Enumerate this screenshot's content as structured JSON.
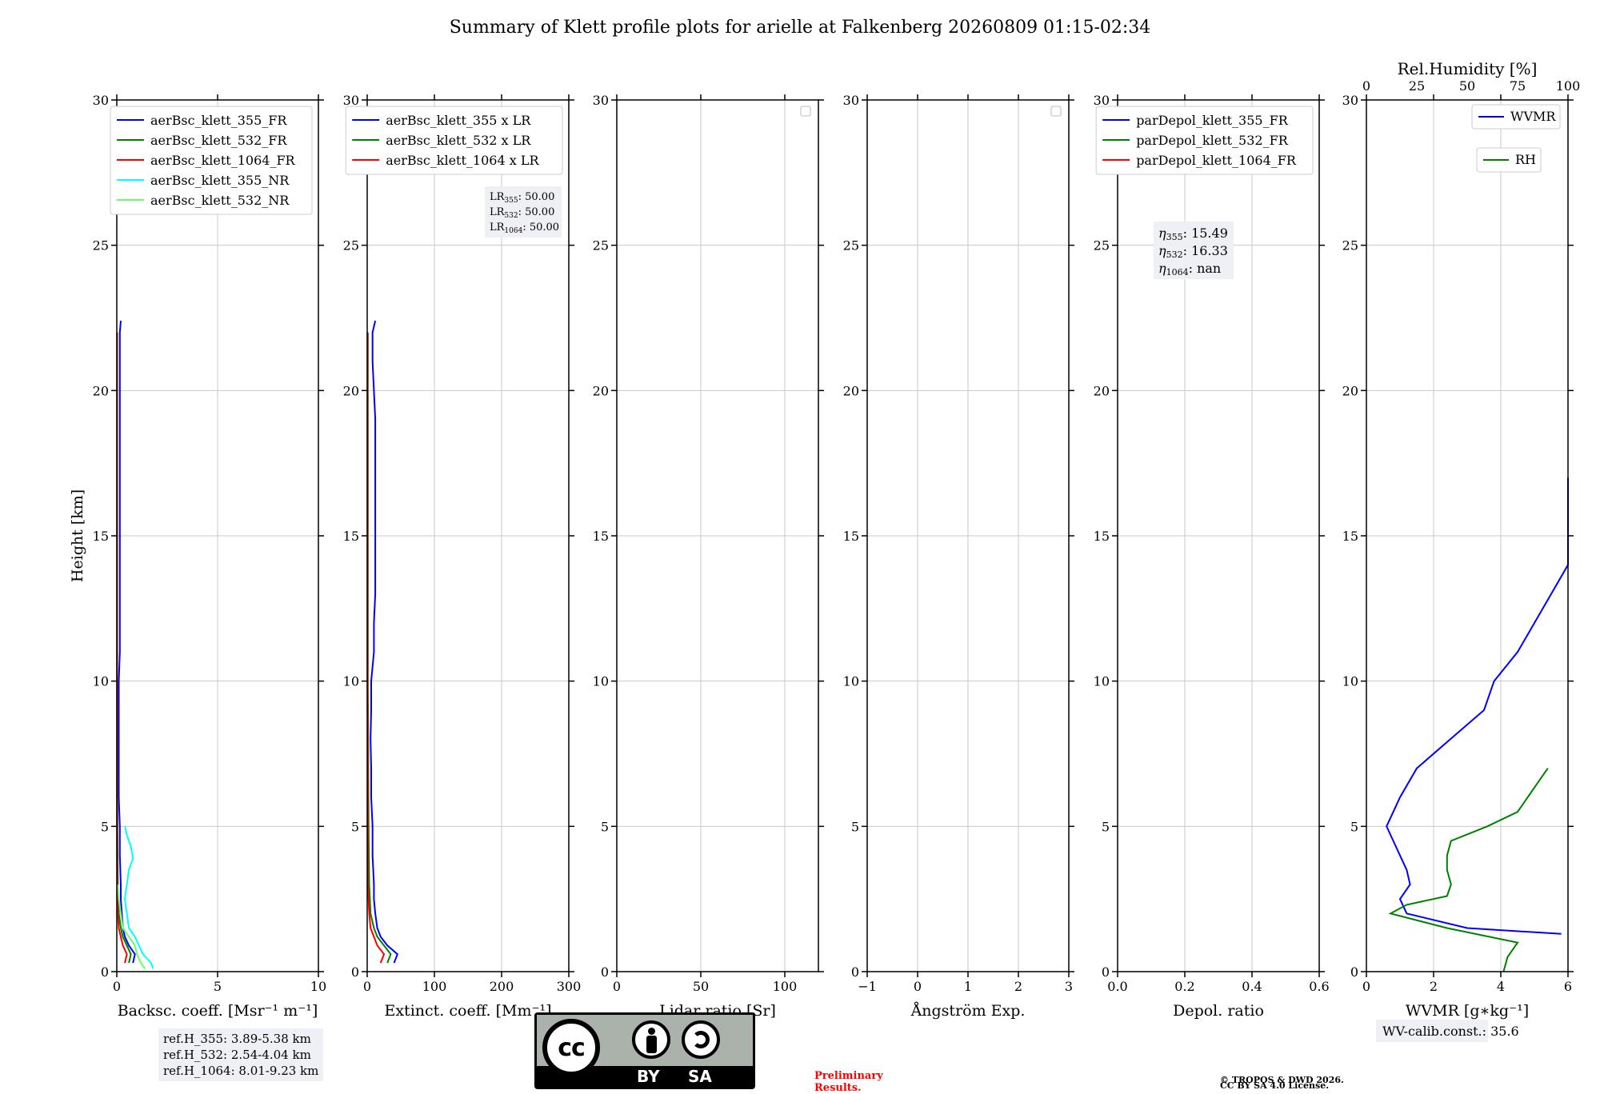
{
  "page_title": "Summary of Klett profile plots for arielle at Falkenberg 20260809 01:15-02:34",
  "y_axis_label": "Height [km]",
  "colors": {
    "c355": "#0000ff",
    "c532": "#008000",
    "c1064": "#ff0000",
    "c355nr": "#00ffff",
    "c532nr": "#66ff66",
    "grid": "#c8c8c8",
    "notebox": "#eef0f5",
    "prelim": "#ff0000"
  },
  "chart_data": [
    {
      "id": "backscatter",
      "type": "line",
      "xlabel": "Backsc. coeff. [Msr⁻¹ m⁻¹]",
      "ylabel": "Height [km]",
      "xlim": [
        0,
        10
      ],
      "ylim": [
        0,
        30
      ],
      "xticks": [
        0,
        5,
        10
      ],
      "yticks": [
        0,
        5,
        10,
        15,
        20,
        25,
        30
      ],
      "grid": true,
      "legend": "top-right",
      "series": [
        {
          "name": "aerBsc_klett_355_FR",
          "color": "#0000ff",
          "y": [
            0.3,
            0.6,
            0.9,
            1.2,
            1.5,
            2,
            2.5,
            3,
            4,
            5,
            6,
            7,
            8,
            9,
            10,
            11,
            12,
            13,
            14,
            15,
            16,
            17,
            18,
            19,
            20,
            21,
            22,
            22.4
          ],
          "x": [
            0.8,
            0.9,
            0.6,
            0.4,
            0.3,
            0.25,
            0.2,
            0.2,
            0.15,
            0.15,
            0.1,
            0.1,
            0.1,
            0.1,
            0.1,
            0.15,
            0.15,
            0.15,
            0.15,
            0.15,
            0.15,
            0.15,
            0.15,
            0.15,
            0.15,
            0.15,
            0.15,
            0.2
          ]
        },
        {
          "name": "aerBsc_klett_532_FR",
          "color": "#008000",
          "y": [
            0.3,
            0.6,
            0.9,
            1.2,
            1.5,
            2,
            3,
            5,
            10,
            20,
            22
          ],
          "x": [
            0.6,
            0.7,
            0.5,
            0.3,
            0.2,
            0.1,
            0.05,
            0.03,
            0.02,
            0.02,
            0.02
          ]
        },
        {
          "name": "aerBsc_klett_1064_FR",
          "color": "#ff0000",
          "y": [
            0.3,
            0.6,
            0.9,
            1.2,
            1.5,
            2,
            3,
            5,
            10,
            20,
            22
          ],
          "x": [
            0.4,
            0.5,
            0.3,
            0.2,
            0.1,
            0.05,
            0.02,
            0.01,
            0.01,
            0.01,
            0.01
          ]
        },
        {
          "name": "aerBsc_klett_355_NR",
          "color": "#00ffff",
          "y": [
            0.1,
            0.3,
            0.6,
            0.9,
            1.2,
            1.5,
            2,
            2.5,
            3,
            3.5,
            3.9,
            4.3,
            4.7,
            5
          ],
          "x": [
            1.8,
            1.7,
            1.3,
            1.1,
            0.9,
            0.6,
            0.5,
            0.4,
            0.5,
            0.6,
            0.8,
            0.7,
            0.5,
            0.4
          ]
        },
        {
          "name": "aerBsc_klett_532_NR",
          "color": "#66ff66",
          "y": [
            0.1,
            0.3,
            0.6,
            0.9,
            1.2,
            1.5,
            2,
            2.5,
            3
          ],
          "x": [
            1.4,
            1.2,
            1.0,
            0.9,
            0.6,
            0.3,
            0.2,
            0.1,
            0.05
          ]
        }
      ]
    },
    {
      "id": "extinction",
      "type": "line",
      "xlabel": "Extinct. coeff. [Mm⁻¹]",
      "xlim": [
        0,
        300
      ],
      "ylim": [
        0,
        30
      ],
      "xticks": [
        0,
        100,
        200,
        300
      ],
      "yticks": [
        0,
        5,
        10,
        15,
        20,
        25,
        30
      ],
      "grid": true,
      "legend": "top-right",
      "series": [
        {
          "name": "aerBsc_klett_355 x LR",
          "color": "#0000ff",
          "y": [
            0.3,
            0.6,
            0.9,
            1.2,
            1.5,
            2,
            2.5,
            3,
            4,
            5,
            6,
            7,
            8,
            9,
            10,
            11,
            12,
            13,
            14,
            15,
            16,
            17,
            18,
            19,
            20,
            21,
            22,
            22.4
          ],
          "x": [
            40,
            45,
            30,
            20,
            15,
            12,
            10,
            10,
            8,
            8,
            6,
            6,
            5,
            6,
            6,
            10,
            10,
            12,
            12,
            12,
            12,
            12,
            12,
            12,
            10,
            8,
            8,
            12
          ]
        },
        {
          "name": "aerBsc_klett_532 x LR",
          "color": "#008000",
          "y": [
            0.3,
            0.6,
            0.9,
            1.2,
            1.5,
            2,
            3,
            5,
            10,
            20,
            22
          ],
          "x": [
            30,
            35,
            25,
            15,
            10,
            5,
            3,
            2,
            1,
            1,
            1
          ]
        },
        {
          "name": "aerBsc_klett_1064 x LR",
          "color": "#ff0000",
          "y": [
            0.3,
            0.6,
            0.9,
            1.2,
            1.5,
            2,
            3,
            5,
            10,
            20,
            22
          ],
          "x": [
            20,
            25,
            15,
            10,
            5,
            3,
            1,
            1,
            0.5,
            0.5,
            0.5
          ]
        }
      ],
      "annotation": [
        {
          "label": "LR",
          "sub": "355",
          "value": ": 50.00"
        },
        {
          "label": "LR",
          "sub": "532",
          "value": ": 50.00"
        },
        {
          "label": "LR",
          "sub": "1064",
          "value": ": 50.00"
        }
      ]
    },
    {
      "id": "lidar_ratio",
      "type": "line",
      "xlabel": "Lidar ratio [Sr]",
      "xlim": [
        0,
        120
      ],
      "ylim": [
        0,
        30
      ],
      "xticks": [
        0,
        50,
        100
      ],
      "yticks": [
        0,
        5,
        10,
        15,
        20,
        25,
        30
      ],
      "grid": true,
      "legend": "top-right",
      "series": []
    },
    {
      "id": "angstrom",
      "type": "line",
      "xlabel": "Ångström Exp.",
      "xlim": [
        -1,
        3
      ],
      "ylim": [
        0,
        30
      ],
      "xticks": [
        -1,
        0,
        1,
        2,
        3
      ],
      "yticks": [
        0,
        5,
        10,
        15,
        20,
        25,
        30
      ],
      "grid": true,
      "legend": "top-right",
      "series": []
    },
    {
      "id": "depol",
      "type": "line",
      "xlabel": "Depol. ratio",
      "xlim": [
        0,
        0.6
      ],
      "ylim": [
        0,
        30
      ],
      "xticks": [
        0.0,
        0.2,
        0.4,
        0.6
      ],
      "xtick_labels": [
        "0.0",
        "0.2",
        "0.4",
        "0.6"
      ],
      "yticks": [
        0,
        5,
        10,
        15,
        20,
        25,
        30
      ],
      "grid": true,
      "legend": "top-right",
      "series": [
        {
          "name": "parDepol_klett_355_FR",
          "color": "#0000ff"
        },
        {
          "name": "parDepol_klett_532_FR",
          "color": "#008000"
        },
        {
          "name": "parDepol_klett_1064_FR",
          "color": "#ff0000"
        }
      ],
      "annotation": [
        {
          "label": "η",
          "sub": "355",
          "value": ": 15.49"
        },
        {
          "label": "η",
          "sub": "532",
          "value": ": 16.33"
        },
        {
          "label": "η",
          "sub": "1064",
          "value": ": nan"
        }
      ]
    },
    {
      "id": "wvmr",
      "type": "line",
      "xlabel": "WVMR [g∗kg⁻¹]",
      "top_xlabel": "Rel.Humidity [%]",
      "xlim": [
        0,
        6
      ],
      "top_xlim": [
        0,
        100
      ],
      "ylim": [
        0,
        30
      ],
      "xticks": [
        0,
        2,
        4,
        6
      ],
      "top_xticks": [
        0,
        25,
        50,
        75,
        100
      ],
      "yticks": [
        0,
        5,
        10,
        15,
        20,
        25,
        30
      ],
      "grid": true,
      "series": [
        {
          "name": "WVMR",
          "color": "#0000ff",
          "axis": "bottom",
          "y": [
            1.3,
            1.5,
            2,
            2.5,
            3,
            3.5,
            4,
            4.5,
            5,
            5.5,
            6,
            7,
            8,
            9,
            10,
            11,
            12,
            13,
            14,
            15,
            16,
            17
          ],
          "x": [
            5.8,
            3.0,
            1.2,
            1.0,
            1.3,
            1.2,
            1.0,
            0.8,
            0.6,
            0.8,
            1.0,
            1.5,
            2.5,
            3.5,
            3.8,
            4.5,
            5,
            5.5,
            6,
            6,
            6,
            6
          ]
        },
        {
          "name": "RH",
          "color": "#008000",
          "axis": "top",
          "y": [
            0,
            0.5,
            1,
            1.5,
            2,
            2.3,
            2.6,
            3,
            3.5,
            4,
            4.5,
            5,
            5.5,
            6,
            6.5,
            7
          ],
          "x": [
            68,
            70,
            75,
            40,
            12,
            20,
            40,
            42,
            40,
            40,
            42,
            60,
            75,
            80,
            85,
            90
          ]
        }
      ],
      "annotation": [
        {
          "text": "WV-calib.const.: 35.6"
        }
      ]
    }
  ],
  "ref_heights": [
    "ref.H_355: 3.89-5.38 km",
    "ref.H_532: 2.54-4.04 km",
    "ref.H_1064: 8.01-9.23 km"
  ],
  "license_badge": {
    "by": "BY",
    "sa": "SA",
    "cc": "cc"
  },
  "preliminary": [
    "Preliminary",
    "Results."
  ],
  "copyright": [
    "© TROPOS & DWD 2026.",
    "CC BY SA 4.0 License."
  ]
}
